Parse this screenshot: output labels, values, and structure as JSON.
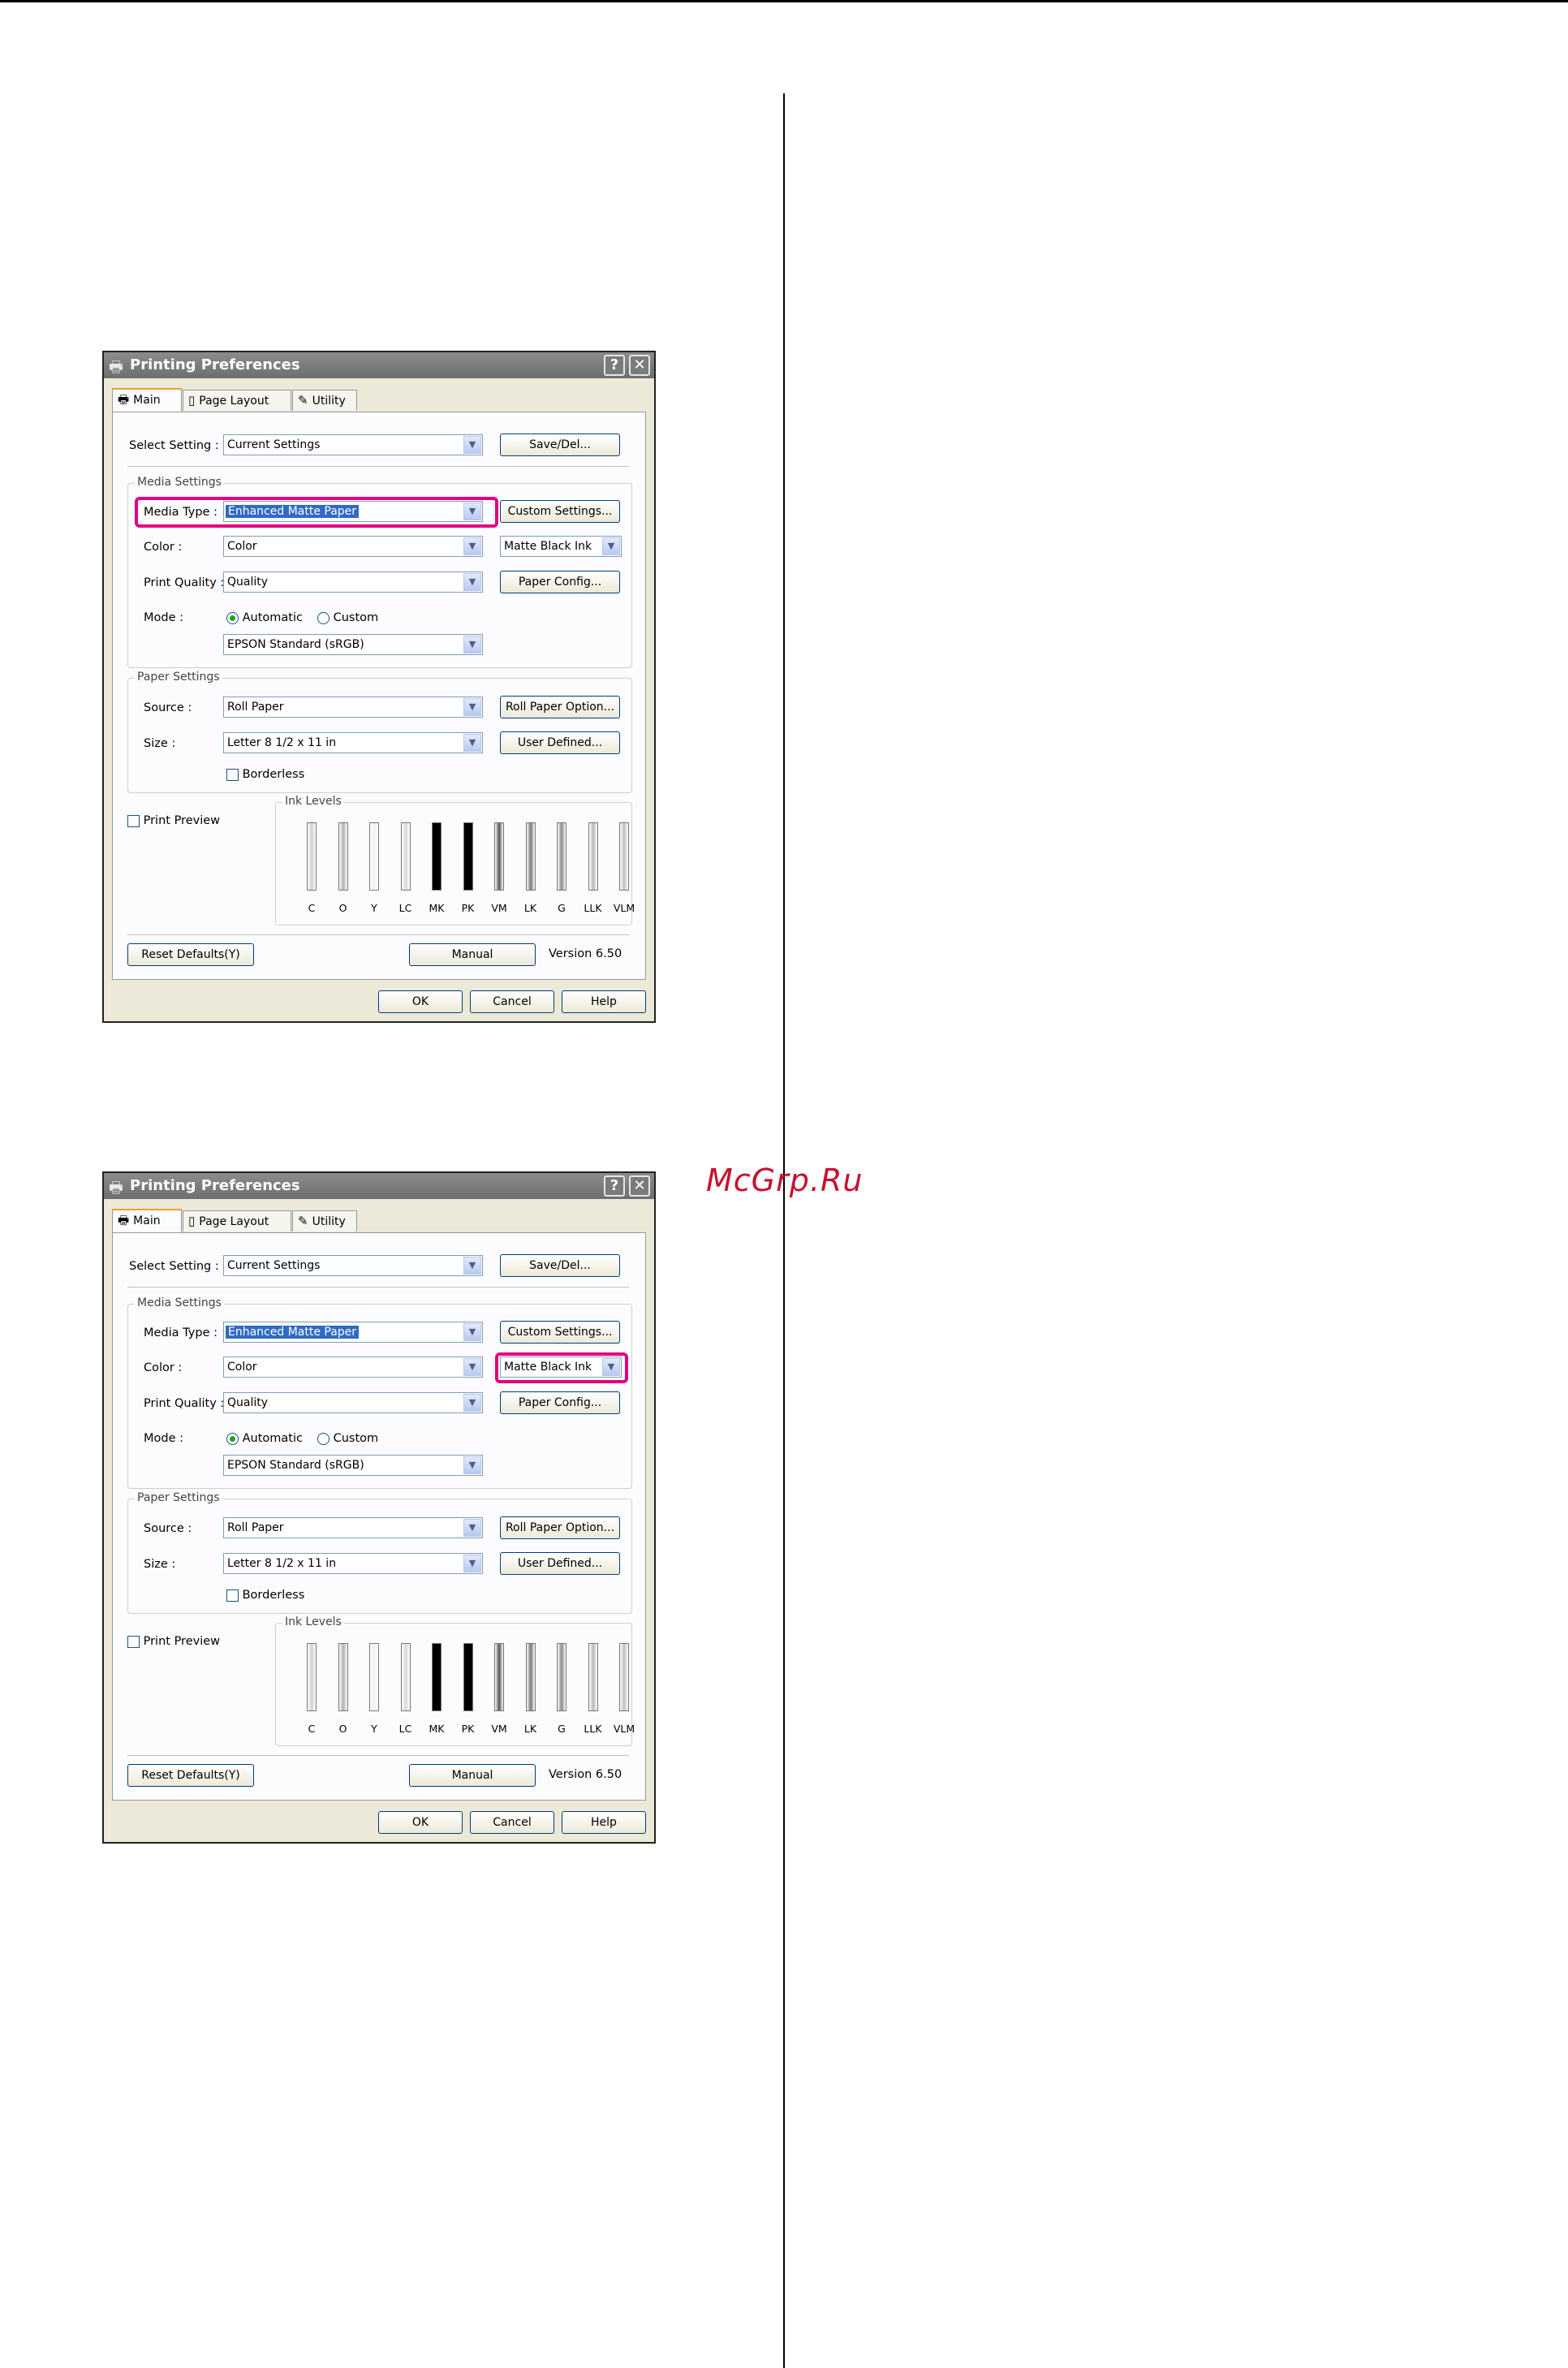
{
  "watermark": "McGrp.Ru",
  "dialogs": [
    {
      "title": "Printing Preferences",
      "help_glyph": "?",
      "close_glyph": "✕",
      "tabs": [
        "Main",
        "Page Layout",
        "Utility"
      ],
      "select_setting": {
        "label": "Select Setting :",
        "value": "Current Settings",
        "button": "Save/Del..."
      },
      "media_settings": {
        "title": "Media Settings",
        "media_type": {
          "label": "Media Type :",
          "value": "Enhanced Matte Paper",
          "button": "Custom Settings..."
        },
        "color": {
          "label": "Color :",
          "value": "Color",
          "ink": "Matte Black Ink"
        },
        "print_quality": {
          "label": "Print Quality :",
          "value": "Quality",
          "button": "Paper Config..."
        },
        "mode": {
          "label": "Mode :",
          "automatic": "Automatic",
          "custom": "Custom",
          "selected": "Automatic",
          "value": "EPSON Standard (sRGB)"
        }
      },
      "paper_settings": {
        "title": "Paper Settings",
        "source": {
          "label": "Source :",
          "value": "Roll Paper",
          "button": "Roll Paper Option..."
        },
        "size": {
          "label": "Size :",
          "value": "Letter 8 1/2 x 11 in",
          "button": "User Defined..."
        },
        "borderless": "Borderless"
      },
      "print_preview": "Print Preview",
      "ink_levels": {
        "title": "Ink Levels",
        "inks": [
          "C",
          "O",
          "Y",
          "LC",
          "MK",
          "PK",
          "VM",
          "LK",
          "G",
          "LLK",
          "VLM"
        ]
      },
      "reset_defaults": "Reset Defaults(Y)",
      "manual": "Manual",
      "version": "Version 6.50",
      "ok": "OK",
      "cancel": "Cancel",
      "help": "Help",
      "highlight": "media_type"
    },
    {
      "title": "Printing Preferences",
      "help_glyph": "?",
      "close_glyph": "✕",
      "tabs": [
        "Main",
        "Page Layout",
        "Utility"
      ],
      "select_setting": {
        "label": "Select Setting :",
        "value": "Current Settings",
        "button": "Save/Del..."
      },
      "media_settings": {
        "title": "Media Settings",
        "media_type": {
          "label": "Media Type :",
          "value": "Enhanced Matte Paper",
          "button": "Custom Settings..."
        },
        "color": {
          "label": "Color :",
          "value": "Color",
          "ink": "Matte Black Ink"
        },
        "print_quality": {
          "label": "Print Quality :",
          "value": "Quality",
          "button": "Paper Config..."
        },
        "mode": {
          "label": "Mode :",
          "automatic": "Automatic",
          "custom": "Custom",
          "selected": "Automatic",
          "value": "EPSON Standard (sRGB)"
        }
      },
      "paper_settings": {
        "title": "Paper Settings",
        "source": {
          "label": "Source :",
          "value": "Roll Paper",
          "button": "Roll Paper Option..."
        },
        "size": {
          "label": "Size :",
          "value": "Letter 8 1/2 x 11 in",
          "button": "User Defined..."
        },
        "borderless": "Borderless"
      },
      "print_preview": "Print Preview",
      "ink_levels": {
        "title": "Ink Levels",
        "inks": [
          "C",
          "O",
          "Y",
          "LC",
          "MK",
          "PK",
          "VM",
          "LK",
          "G",
          "LLK",
          "VLM"
        ]
      },
      "reset_defaults": "Reset Defaults(Y)",
      "manual": "Manual",
      "version": "Version 6.50",
      "ok": "OK",
      "cancel": "Cancel",
      "help": "Help",
      "highlight": "ink_select"
    }
  ],
  "colors": {
    "highlight": "#e3007f",
    "watermark": "#c8102e"
  }
}
